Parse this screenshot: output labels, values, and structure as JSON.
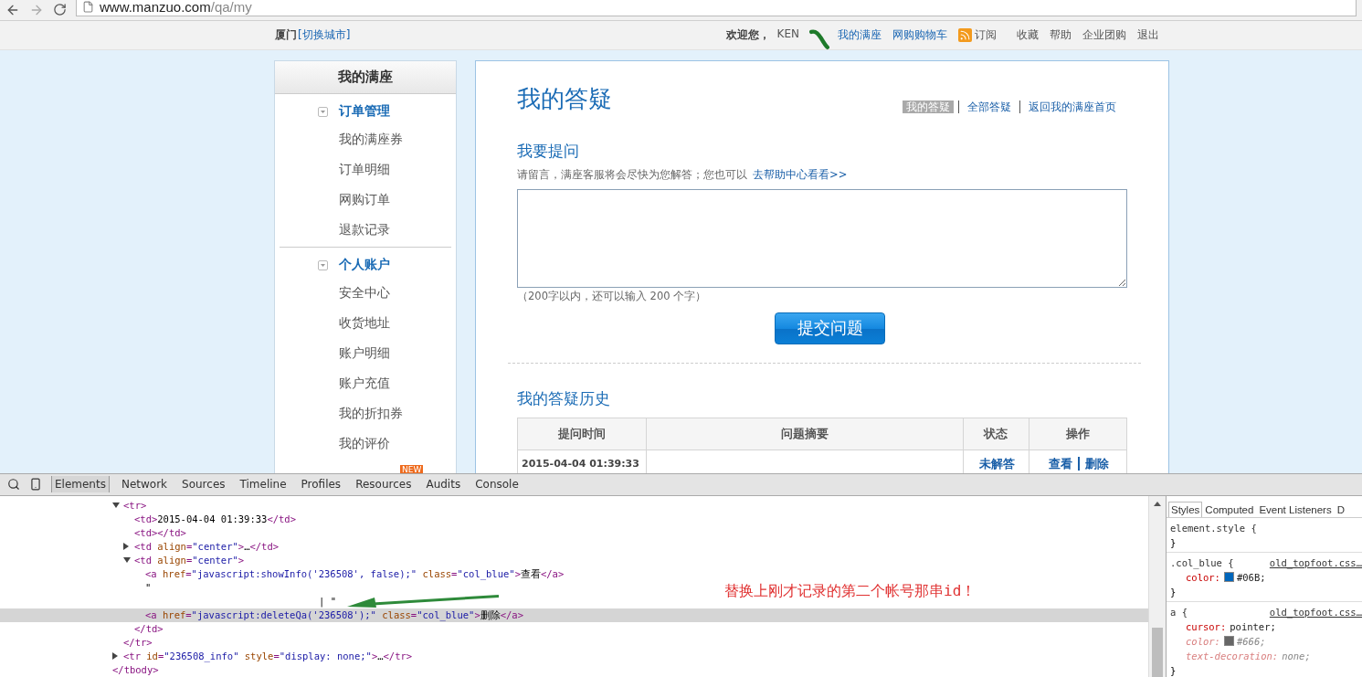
{
  "browser": {
    "url_host": "www.manzuo.com",
    "url_path": "/qa/my"
  },
  "top_bar": {
    "city": "厦门",
    "switch_city": "[切换城市]",
    "welcome": "欢迎您，",
    "username": "KEN",
    "links": [
      {
        "label": "我的满座",
        "kind": "link"
      },
      {
        "label": "网购购物车",
        "kind": "link"
      },
      {
        "label": "订阅",
        "kind": "rss"
      },
      {
        "label": "收藏",
        "kind": "plain"
      },
      {
        "label": "帮助",
        "kind": "plain"
      },
      {
        "label": "企业团购",
        "kind": "plain"
      },
      {
        "label": "退出",
        "kind": "plain"
      }
    ]
  },
  "sidebar": {
    "title": "我的满座",
    "groups": [
      {
        "label": "订单管理",
        "expanded": true,
        "items": [
          "我的满座券",
          "订单明细",
          "网购订单",
          "退款记录"
        ]
      },
      {
        "label": "个人账户",
        "expanded": true,
        "items": [
          "安全中心",
          "收货地址",
          "账户明细",
          "账户充值",
          "我的折扣券",
          "我的评价"
        ],
        "more_badge": "NEW"
      }
    ]
  },
  "main": {
    "title": "我的答疑",
    "tabs": [
      {
        "label": "我的答疑",
        "selected": true
      },
      {
        "label": "全部答疑",
        "selected": false
      },
      {
        "label": "返回我的满座首页",
        "selected": false
      }
    ],
    "ask": {
      "heading": "我要提问",
      "hint": "请留言，满座客服将会尽快为您解答；您也可以",
      "help_link": "去帮助中心看看>>",
      "counter": "（200字以内，还可以输入 200 个字）",
      "submit": "提交问题"
    },
    "history": {
      "heading": "我的答疑历史",
      "columns": [
        "提问时间",
        "问题摘要",
        "状态",
        "操作"
      ],
      "rows": [
        {
          "time": "2015-04-04 01:39:33",
          "status": "未解答",
          "actions": [
            "查看",
            "删除"
          ]
        }
      ]
    }
  },
  "devtools": {
    "tabs": [
      {
        "label": "Elements",
        "selected": true
      },
      {
        "label": "Network",
        "selected": false
      },
      {
        "label": "Sources",
        "selected": false
      },
      {
        "label": "Timeline",
        "selected": false
      },
      {
        "label": "Profiles",
        "selected": false
      },
      {
        "label": "Resources",
        "selected": false
      },
      {
        "label": "Audits",
        "selected": false
      },
      {
        "label": "Console",
        "selected": false
      }
    ],
    "dom_tree": {
      "closing": "</tbody>",
      "children": [
        {
          "markup": "<tr>",
          "expanded": true,
          "selected": false,
          "closing": "</tr>",
          "children": [
            {
              "markup": "<td>2015-04-04 01:39:33</td>",
              "selected": false
            },
            {
              "markup": "<td></td>",
              "selected": false
            },
            {
              "markup": "<td align=\"center\">…</td>",
              "expanded": false,
              "selected": false
            },
            {
              "markup": "<td align=\"center\">",
              "expanded": true,
              "selected": false,
              "closing": "</td>",
              "children": [
                {
                  "markup": "<a href=\"javascript:showInfo('236508', false);\" class=\"col_blue\">查看</a>",
                  "selected": false
                },
                {
                  "markup": "\"",
                  "tail": "| \"",
                  "selected": false
                },
                {
                  "markup": "<a href=\"javascript:deleteQa('236508');\" class=\"col_blue\">删除</a>",
                  "selected": true
                }
              ]
            }
          ]
        },
        {
          "markup": "<tr id=\"236508_info\" style=\"display: none;\">…</tr>",
          "expanded": false,
          "selected": false
        }
      ]
    },
    "annotation": "替换上刚才记录的第二个帐号那串id！",
    "styles": {
      "tabs": [
        {
          "label": "Styles",
          "selected": true
        },
        {
          "label": "Computed",
          "selected": false
        },
        {
          "label": "Event Listeners",
          "selected": false
        },
        {
          "label": "D",
          "selected": false
        }
      ],
      "rules": [
        {
          "selector": "element.style {",
          "close": "}"
        },
        {
          "selector": ".col_blue {",
          "source": "old_topfoot.css…",
          "close": "}",
          "props": [
            {
              "name": "color:",
              "value": "#06B;",
              "color": "#0066bb",
              "overridden": false
            }
          ]
        },
        {
          "selector": "a {",
          "source": "old_topfoot.css…",
          "close": "}",
          "props": [
            {
              "name": "cursor:",
              "value": "pointer;",
              "overridden": false
            },
            {
              "name": "color:",
              "value": "#666;",
              "color": "#666666",
              "overridden": true
            },
            {
              "name": "text-decoration:",
              "value": "none;",
              "overridden": true
            }
          ]
        }
      ]
    }
  }
}
